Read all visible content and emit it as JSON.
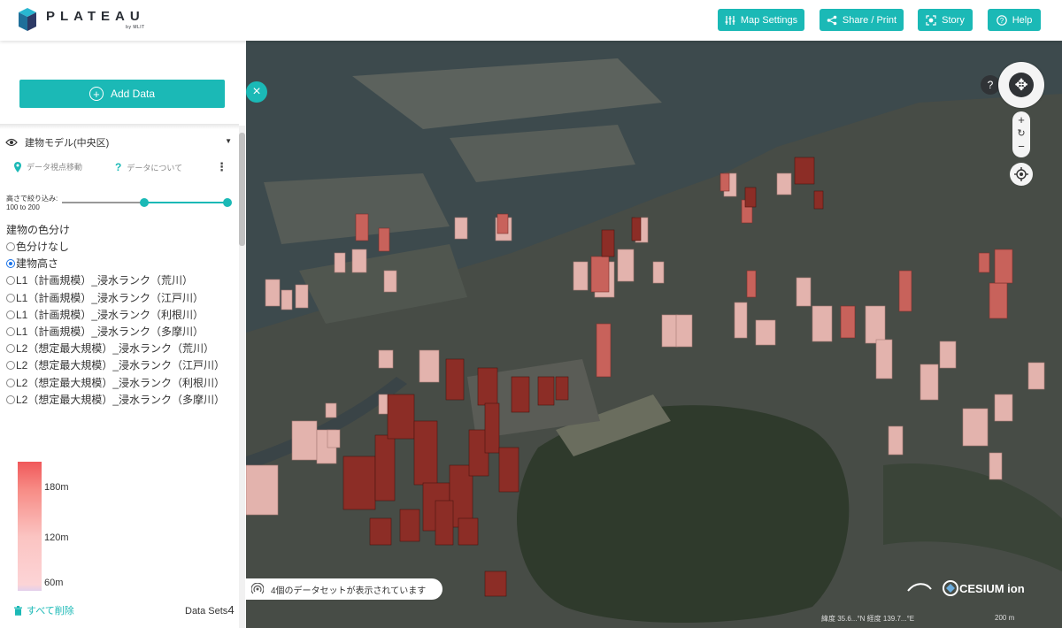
{
  "header": {
    "logo_title": "PLATEAU",
    "logo_sub": "by MLIT",
    "buttons": [
      {
        "label": "Map Settings",
        "icon": "sliders-icon"
      },
      {
        "label": "Share / Print",
        "icon": "share-icon"
      },
      {
        "label": "Story",
        "icon": "story-icon"
      },
      {
        "label": "Help",
        "icon": "help-icon"
      }
    ]
  },
  "sidebar": {
    "add_data_label": "Add Data",
    "dataset": {
      "name": "建物モデル(中央区)",
      "move_view_label": "データ視点移動",
      "about_label": "データについて"
    },
    "height_filter": {
      "label": "高さで絞り込み:",
      "range_text": "100 to 200",
      "min_value": 100,
      "max_value": 200
    },
    "coloring": {
      "title": "建物の色分け",
      "options": [
        {
          "label": "色分けなし",
          "selected": false
        },
        {
          "label": "建物高さ",
          "selected": true
        },
        {
          "label": "L1（計画規模）_浸水ランク（荒川）",
          "selected": false
        },
        {
          "label": "L1（計画規模）_浸水ランク（江戸川）",
          "selected": false
        },
        {
          "label": "L1（計画規模）_浸水ランク（利根川）",
          "selected": false
        },
        {
          "label": "L1（計画規模）_浸水ランク（多摩川）",
          "selected": false
        },
        {
          "label": "L2（想定最大規模）_浸水ランク（荒川）",
          "selected": false
        },
        {
          "label": "L2（想定最大規模）_浸水ランク（江戸川）",
          "selected": false
        },
        {
          "label": "L2（想定最大規模）_浸水ランク（利根川）",
          "selected": false
        },
        {
          "label": "L2（想定最大規模）_浸水ランク（多摩川）",
          "selected": false
        }
      ]
    },
    "legend": {
      "ticks": [
        "180m",
        "120m",
        "60m"
      ],
      "colors": [
        "#f0585a",
        "#f78b85",
        "#fbc4c2",
        "#fcd4d6",
        "#e2d0ec"
      ]
    },
    "footer": {
      "delete_all_label": "すべて削除",
      "datasets_label": "Data Sets",
      "datasets_count": "4"
    }
  },
  "map": {
    "status_text": "4個のデータセットが表示されています",
    "attribution": "CESIUM ion",
    "coords_text": "緯度 35.6...°N   経度 139.7...°E",
    "scale_text": "200 m",
    "colors": {
      "water": "#3e4a4c",
      "land": "#4a4f49",
      "park": "#2f3b2c",
      "building_high": "#8a2b24",
      "building_mid": "#c45f57",
      "building_low": "#e8b8b2",
      "accent": "#1bb9b6"
    }
  }
}
